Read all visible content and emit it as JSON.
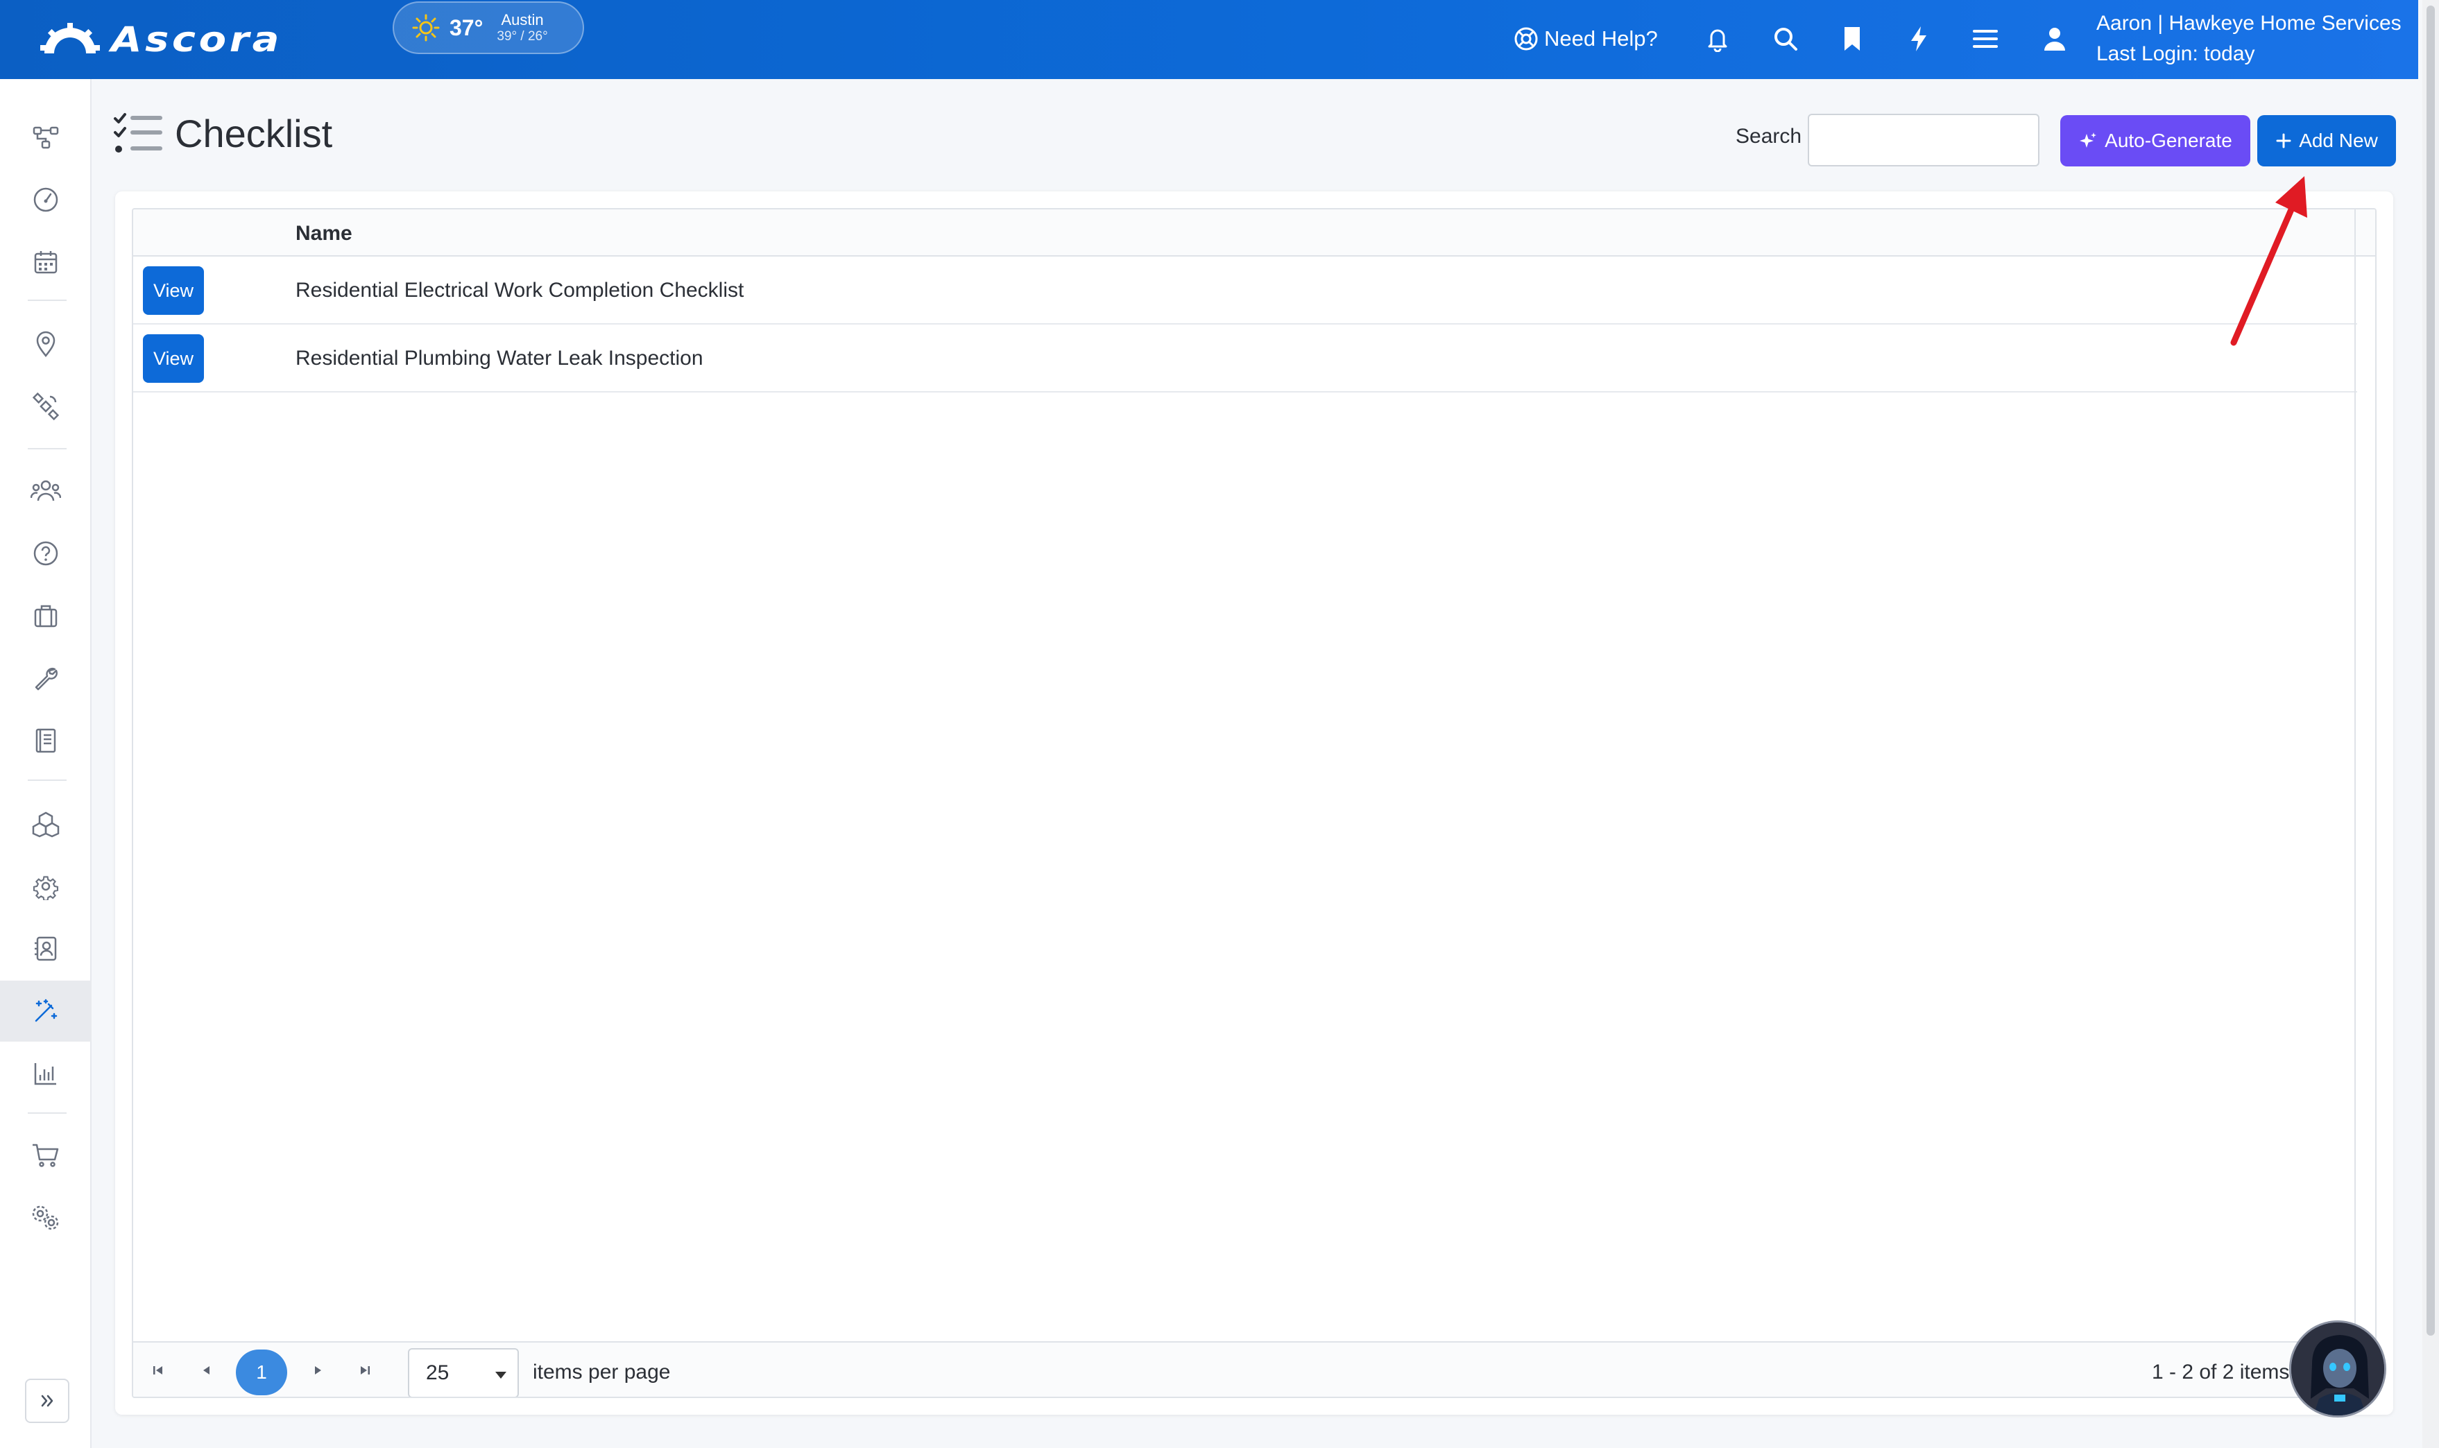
{
  "app": {
    "brand": "Ascora"
  },
  "weather": {
    "temp": "37°",
    "city": "Austin",
    "range": "39° / 26°"
  },
  "header": {
    "help_label": "Need Help?",
    "user_line1": "Aaron | Hawkeye Home Services",
    "user_line2": "Last Login: today"
  },
  "page": {
    "title": "Checklist",
    "search_label": "Search",
    "search_value": "",
    "auto_generate_label": "Auto-Generate",
    "add_new_label": "Add New"
  },
  "grid": {
    "columns": [
      "Name"
    ],
    "rows": [
      {
        "action": "View",
        "name": "Residential Electrical Work Completion Checklist"
      },
      {
        "action": "View",
        "name": "Residential Plumbing Water Leak Inspection"
      }
    ]
  },
  "pager": {
    "current_page": "1",
    "page_size": "25",
    "items_per_page_label": "items per page",
    "info": "1 - 2 of 2 items"
  },
  "colors": {
    "topbar": "#0d6ad8",
    "primary": "#0d6ad8",
    "auto_generate": "#6a4cf5",
    "annotation_arrow": "#e01b24"
  },
  "sidebar_icons": [
    "workflow-icon",
    "dashboard-gauge-icon",
    "calendar-icon",
    "map-pin-icon",
    "satellite-icon",
    "users-icon",
    "help-circle-icon",
    "briefcase-icon",
    "wrench-icon",
    "book-icon",
    "boxes-icon",
    "settings-icon",
    "contacts-icon",
    "magic-wand-icon",
    "bar-chart-icon",
    "cart-icon",
    "gears-icon"
  ]
}
